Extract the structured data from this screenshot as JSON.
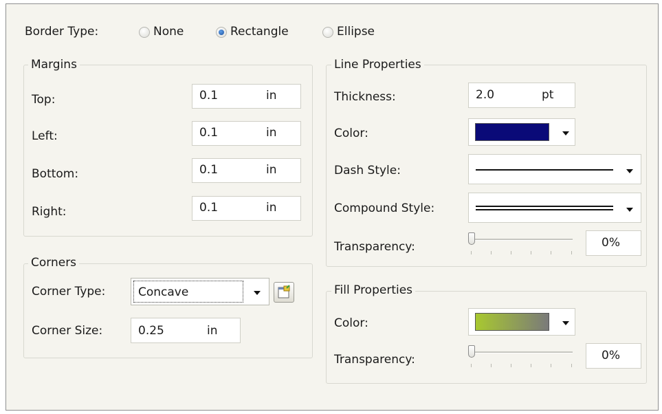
{
  "border_type": {
    "label": "Border Type:",
    "options": [
      {
        "label": "None",
        "selected": false
      },
      {
        "label": "Rectangle",
        "selected": true
      },
      {
        "label": "Ellipse",
        "selected": false
      }
    ]
  },
  "margins": {
    "title": "Margins",
    "rows": [
      {
        "label": "Top:",
        "value": "0.1",
        "unit": "in"
      },
      {
        "label": "Left:",
        "value": "0.1",
        "unit": "in"
      },
      {
        "label": "Bottom:",
        "value": "0.1",
        "unit": "in"
      },
      {
        "label": "Right:",
        "value": "0.1",
        "unit": "in"
      }
    ]
  },
  "corners": {
    "title": "Corners",
    "type_label": "Corner Type:",
    "type_value": "Concave",
    "size_label": "Corner Size:",
    "size_value": "0.25",
    "size_unit": "in"
  },
  "line_properties": {
    "title": "Line Properties",
    "thickness_label": "Thickness:",
    "thickness_value": "2.0",
    "thickness_unit": "pt",
    "color_label": "Color:",
    "color_hex": "#0a0a78",
    "dash_label": "Dash Style:",
    "compound_label": "Compound Style:",
    "transparency_label": "Transparency:",
    "transparency_value": "0%",
    "transparency_level": 0
  },
  "fill_properties": {
    "title": "Fill Properties",
    "color_label": "Color:",
    "color_gradient_start": "#a8c830",
    "color_gradient_end": "#7a7a7a",
    "transparency_label": "Transparency:",
    "transparency_value": "0%",
    "transparency_level": 0
  }
}
